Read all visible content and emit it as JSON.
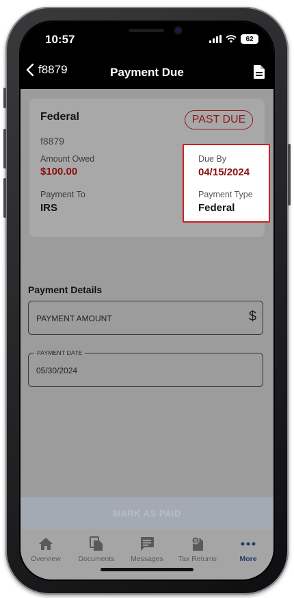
{
  "status_bar": {
    "time": "10:57",
    "battery": "62"
  },
  "nav": {
    "back_label": "f8879",
    "title": "Payment Due"
  },
  "card": {
    "title": "Federal",
    "badge": "PAST DUE",
    "form_id": "f8879",
    "amount_owed_label": "Amount Owed",
    "amount_owed_value": "$100.00",
    "payment_to_label": "Payment To",
    "payment_to_value": "IRS",
    "due_by_label": "Due By",
    "due_by_value": "04/15/2024",
    "payment_type_label": "Payment Type",
    "payment_type_value": "Federal"
  },
  "payment_details": {
    "title": "Payment Details",
    "amount_placeholder": "PAYMENT AMOUNT",
    "currency_symbol": "$",
    "date_label": "PAYMENT DATE",
    "date_value": "05/30/2024"
  },
  "mark_paid_label": "MARK AS PAID",
  "tabs": [
    {
      "label": "Overview",
      "icon": "home-icon",
      "active": false
    },
    {
      "label": "Documents",
      "icon": "documents-icon",
      "active": false
    },
    {
      "label": "Messages",
      "icon": "message-icon",
      "active": false
    },
    {
      "label": "Tax Returns",
      "icon": "tax-returns-icon",
      "active": false
    },
    {
      "label": "More",
      "icon": "more-icon",
      "active": true
    }
  ],
  "colors": {
    "accent_red": "#8c0d0d",
    "highlight_border": "#cc2222",
    "active_tab": "#1f3c6e",
    "overlay_gray": "#9c9c9c"
  }
}
